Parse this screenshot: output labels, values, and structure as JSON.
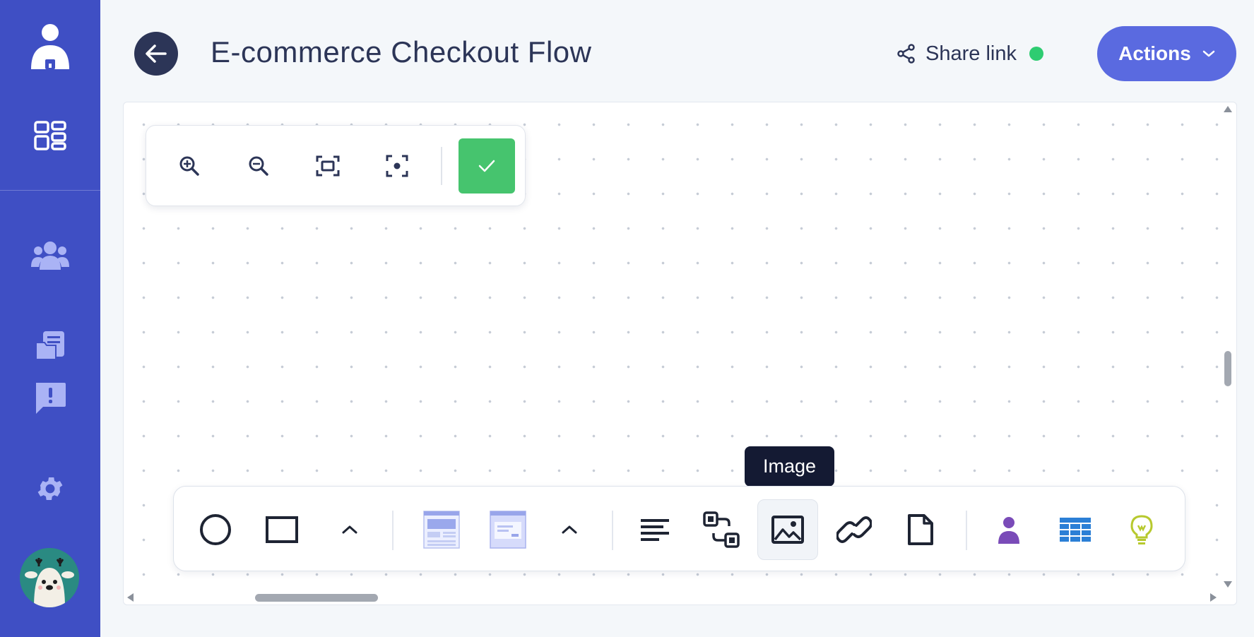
{
  "colors": {
    "sidebar": "#3f4fc4",
    "title": "#2c3557",
    "actions_button": "#5a6ae0",
    "confirm_button": "#46c46e",
    "status_online": "#2ecc71",
    "tooltip_bg": "#141a33"
  },
  "sidebar": {
    "items": [
      {
        "icon": "user-profile-icon"
      },
      {
        "icon": "dashboard-grid-icon"
      },
      {
        "icon": "team-users-icon"
      },
      {
        "icon": "documents-icon"
      },
      {
        "icon": "feedback-alert-icon"
      },
      {
        "icon": "settings-gear-icon"
      }
    ],
    "avatar": {
      "icon": "deer-avatar"
    }
  },
  "header": {
    "back_icon": "arrow-left-icon",
    "title": "E-commerce Checkout Flow",
    "share_label": "Share link",
    "share_icon": "share-icon",
    "share_status": "online",
    "actions_label": "Actions",
    "actions_icon": "chevron-down-icon"
  },
  "zoom_toolbar": {
    "items": [
      {
        "icon": "zoom-in-icon"
      },
      {
        "icon": "zoom-out-icon"
      },
      {
        "icon": "fit-screen-icon"
      },
      {
        "icon": "center-focus-icon"
      },
      {
        "icon": "check-icon"
      }
    ]
  },
  "shapes_toolbar": {
    "items": [
      {
        "icon": "circle-icon"
      },
      {
        "icon": "rectangle-icon"
      },
      {
        "icon": "chevron-up-icon"
      },
      {
        "icon": "wireframe-page-icon"
      },
      {
        "icon": "wireframe-dialog-icon"
      },
      {
        "icon": "chevron-up-icon"
      },
      {
        "icon": "text-align-icon"
      },
      {
        "icon": "flow-connector-icon"
      },
      {
        "icon": "image-icon",
        "active": true
      },
      {
        "icon": "link-icon"
      },
      {
        "icon": "document-icon"
      },
      {
        "icon": "person-icon"
      },
      {
        "icon": "table-grid-icon"
      },
      {
        "icon": "lightbulb-icon"
      }
    ]
  },
  "tooltip": {
    "text": "Image"
  }
}
